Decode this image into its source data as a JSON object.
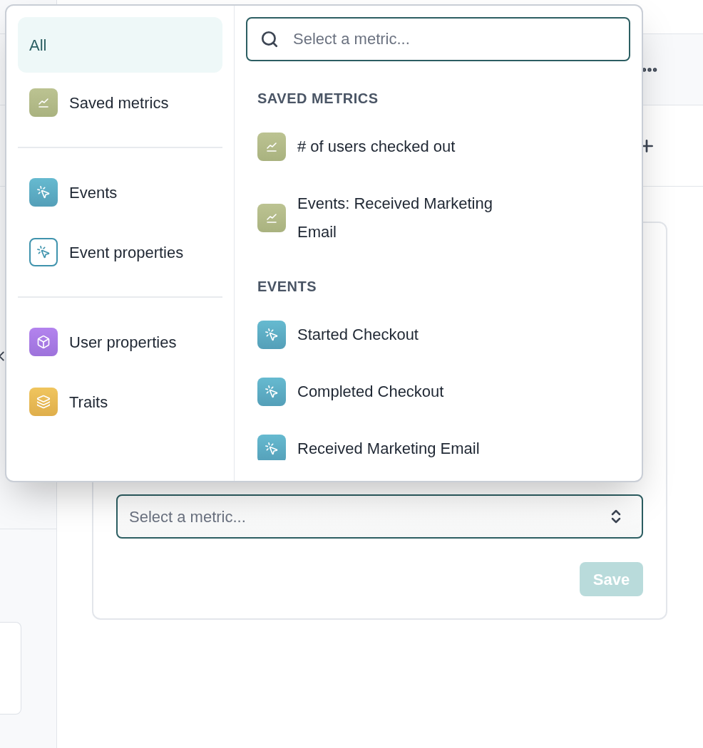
{
  "category_groups": [
    [
      {
        "label": "All",
        "kind": "none",
        "selected": true
      },
      {
        "label": "Saved metrics",
        "kind": "metric",
        "selected": false
      }
    ],
    [
      {
        "label": "Events",
        "kind": "event",
        "selected": false
      },
      {
        "label": "Event properties",
        "kind": "event_outline",
        "selected": false
      }
    ],
    [
      {
        "label": "User properties",
        "kind": "user",
        "selected": false
      },
      {
        "label": "Traits",
        "kind": "trait",
        "selected": false
      }
    ]
  ],
  "search": {
    "placeholder": "Select a metric..."
  },
  "sections": [
    {
      "heading": "SAVED METRICS",
      "items": [
        {
          "label": "# of users checked out",
          "kind": "metric"
        },
        {
          "label": "Events: Received Marketing Email",
          "kind": "metric"
        }
      ]
    },
    {
      "heading": "EVENTS",
      "items": [
        {
          "label": "Started Checkout",
          "kind": "event"
        },
        {
          "label": "Completed Checkout",
          "kind": "event"
        },
        {
          "label": "Received Marketing Email",
          "kind": "event"
        }
      ]
    }
  ],
  "metric_select": {
    "placeholder": "Select a metric..."
  },
  "save_button": {
    "label": "Save",
    "disabled": true
  }
}
